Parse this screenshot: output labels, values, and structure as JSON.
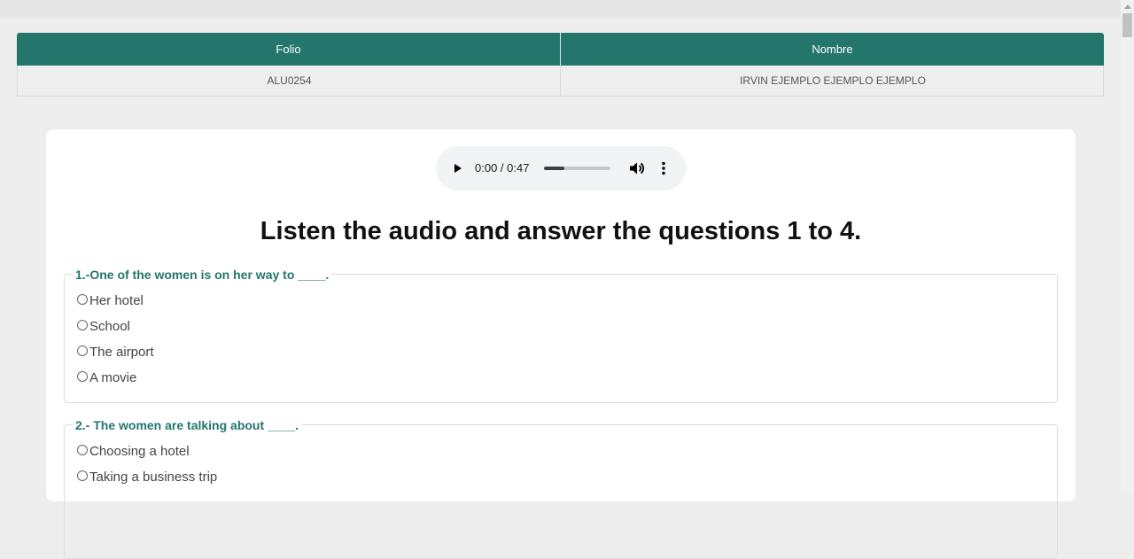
{
  "student_table": {
    "headers": [
      "Folio",
      "Nombre"
    ],
    "row": [
      "ALU0254",
      "IRVIN EJEMPLO EJEMPLO EJEMPLO"
    ]
  },
  "audio_player": {
    "time": "0:00 / 0:47",
    "progress": 0.3,
    "icons": {
      "play": "play-icon",
      "volume": "volume-icon",
      "more": "more-options-icon"
    }
  },
  "section_title": "Listen the audio and answer the questions 1 to 4.",
  "questions": [
    {
      "prompt": "1.-One of the women is on her way to ____.",
      "options": [
        "Her hotel",
        "School",
        "The airport",
        "A movie"
      ]
    },
    {
      "prompt": "2.- The women are talking about ____.",
      "options": [
        "Choosing a hotel",
        "Taking a business trip"
      ]
    }
  ],
  "colors": {
    "accent": "#24766c",
    "page_background": "#ededed",
    "card": "#ffffff"
  }
}
